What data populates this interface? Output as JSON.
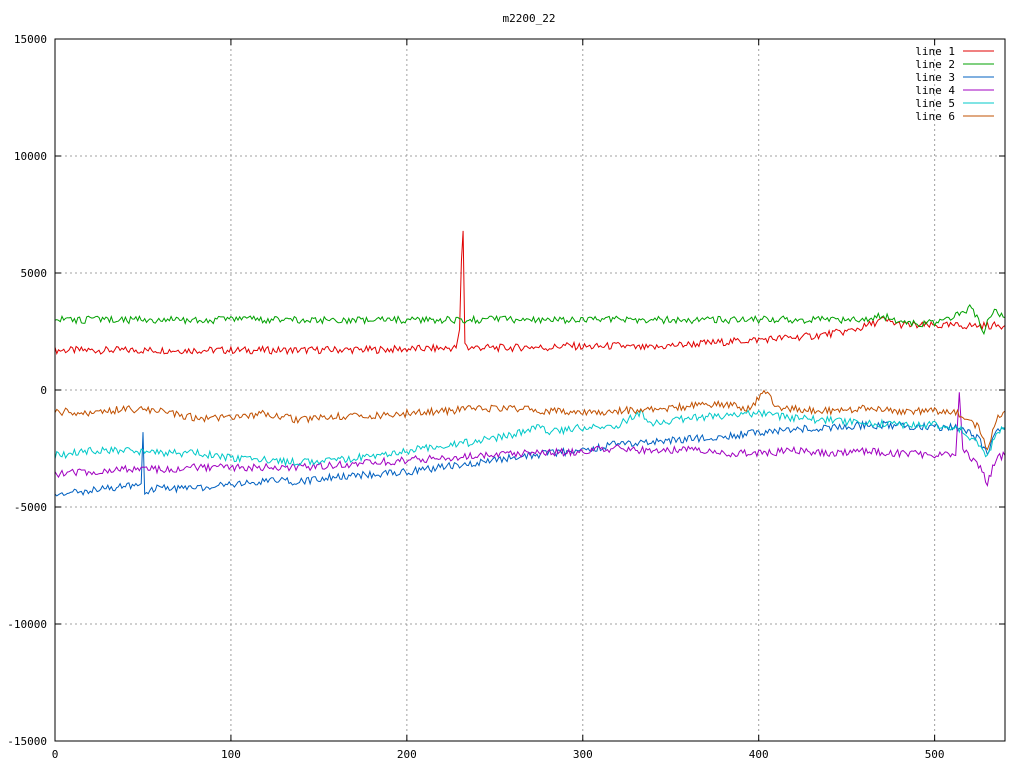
{
  "chart_data": {
    "type": "line",
    "title": "m2200_22",
    "xlabel": "",
    "ylabel": "",
    "xlim": [
      0,
      540
    ],
    "ylim": [
      -15000,
      15000
    ],
    "x_ticks": [
      0,
      100,
      200,
      300,
      400,
      500
    ],
    "y_ticks": [
      -15000,
      -10000,
      -5000,
      0,
      5000,
      10000,
      15000
    ],
    "grid": true,
    "legend_position": "top-right",
    "series": [
      {
        "name": "line 1",
        "color": "#e00000",
        "points": [
          [
            0,
            1700
          ],
          [
            20,
            1700
          ],
          [
            40,
            1700
          ],
          [
            60,
            1700
          ],
          [
            80,
            1700
          ],
          [
            100,
            1700
          ],
          [
            120,
            1700
          ],
          [
            140,
            1700
          ],
          [
            160,
            1720
          ],
          [
            180,
            1720
          ],
          [
            200,
            1750
          ],
          [
            220,
            1780
          ],
          [
            228,
            1800
          ],
          [
            230,
            2600
          ],
          [
            231,
            5500
          ],
          [
            232,
            6800
          ],
          [
            233,
            2000
          ],
          [
            235,
            1800
          ],
          [
            240,
            1820
          ],
          [
            250,
            1800
          ],
          [
            260,
            1800
          ],
          [
            270,
            1850
          ],
          [
            280,
            1800
          ],
          [
            290,
            1900
          ],
          [
            300,
            1850
          ],
          [
            310,
            1850
          ],
          [
            320,
            1900
          ],
          [
            330,
            1800
          ],
          [
            340,
            1800
          ],
          [
            350,
            1900
          ],
          [
            360,
            1950
          ],
          [
            370,
            2000
          ],
          [
            380,
            2050
          ],
          [
            390,
            2100
          ],
          [
            400,
            2150
          ],
          [
            410,
            2200
          ],
          [
            420,
            2250
          ],
          [
            430,
            2300
          ],
          [
            440,
            2400
          ],
          [
            450,
            2500
          ],
          [
            460,
            2700
          ],
          [
            470,
            3000
          ],
          [
            480,
            2800
          ],
          [
            490,
            2750
          ],
          [
            500,
            2750
          ],
          [
            510,
            2750
          ],
          [
            520,
            2750
          ],
          [
            530,
            2750
          ],
          [
            540,
            2750
          ]
        ]
      },
      {
        "name": "line 2",
        "color": "#00a000",
        "points": [
          [
            0,
            3000
          ],
          [
            100,
            3000
          ],
          [
            200,
            3000
          ],
          [
            300,
            3000
          ],
          [
            400,
            3000
          ],
          [
            460,
            3000
          ],
          [
            470,
            3200
          ],
          [
            480,
            2900
          ],
          [
            490,
            2800
          ],
          [
            500,
            2900
          ],
          [
            505,
            3000
          ],
          [
            510,
            3100
          ],
          [
            515,
            3300
          ],
          [
            520,
            3500
          ],
          [
            525,
            3000
          ],
          [
            528,
            2400
          ],
          [
            530,
            2900
          ],
          [
            535,
            3400
          ],
          [
            540,
            3100
          ]
        ]
      },
      {
        "name": "line 3",
        "color": "#0060c0",
        "points": [
          [
            0,
            -4600
          ],
          [
            10,
            -4400
          ],
          [
            20,
            -4300
          ],
          [
            30,
            -4200
          ],
          [
            40,
            -4100
          ],
          [
            49,
            -4000
          ],
          [
            50,
            -1800
          ],
          [
            51,
            -4300
          ],
          [
            60,
            -4200
          ],
          [
            80,
            -4200
          ],
          [
            100,
            -4000
          ],
          [
            120,
            -3900
          ],
          [
            140,
            -3900
          ],
          [
            160,
            -3700
          ],
          [
            180,
            -3600
          ],
          [
            200,
            -3500
          ],
          [
            220,
            -3300
          ],
          [
            240,
            -3100
          ],
          [
            260,
            -2900
          ],
          [
            280,
            -2700
          ],
          [
            300,
            -2600
          ],
          [
            320,
            -2300
          ],
          [
            340,
            -2200
          ],
          [
            360,
            -2100
          ],
          [
            380,
            -2000
          ],
          [
            400,
            -1800
          ],
          [
            420,
            -1700
          ],
          [
            440,
            -1600
          ],
          [
            460,
            -1500
          ],
          [
            480,
            -1500
          ],
          [
            500,
            -1600
          ],
          [
            515,
            -1600
          ],
          [
            525,
            -2100
          ],
          [
            530,
            -2800
          ],
          [
            535,
            -1800
          ],
          [
            540,
            -1700
          ]
        ]
      },
      {
        "name": "line 4",
        "color": "#a000c0",
        "points": [
          [
            0,
            -3600
          ],
          [
            20,
            -3500
          ],
          [
            40,
            -3400
          ],
          [
            60,
            -3400
          ],
          [
            80,
            -3300
          ],
          [
            100,
            -3300
          ],
          [
            120,
            -3300
          ],
          [
            140,
            -3300
          ],
          [
            160,
            -3200
          ],
          [
            180,
            -3100
          ],
          [
            200,
            -3000
          ],
          [
            220,
            -2900
          ],
          [
            240,
            -2800
          ],
          [
            260,
            -2700
          ],
          [
            280,
            -2700
          ],
          [
            300,
            -2600
          ],
          [
            320,
            -2500
          ],
          [
            340,
            -2600
          ],
          [
            360,
            -2500
          ],
          [
            380,
            -2700
          ],
          [
            400,
            -2700
          ],
          [
            420,
            -2600
          ],
          [
            440,
            -2700
          ],
          [
            460,
            -2600
          ],
          [
            480,
            -2700
          ],
          [
            500,
            -2800
          ],
          [
            512,
            -2800
          ],
          [
            514,
            -100
          ],
          [
            516,
            -2500
          ],
          [
            525,
            -3200
          ],
          [
            530,
            -4000
          ],
          [
            535,
            -2900
          ],
          [
            540,
            -2800
          ]
        ]
      },
      {
        "name": "line 5",
        "color": "#00c8c8",
        "points": [
          [
            0,
            -2800
          ],
          [
            20,
            -2600
          ],
          [
            40,
            -2600
          ],
          [
            60,
            -2700
          ],
          [
            80,
            -2700
          ],
          [
            100,
            -2900
          ],
          [
            120,
            -3000
          ],
          [
            140,
            -3100
          ],
          [
            160,
            -3000
          ],
          [
            180,
            -2800
          ],
          [
            200,
            -2600
          ],
          [
            220,
            -2400
          ],
          [
            240,
            -2200
          ],
          [
            260,
            -1900
          ],
          [
            275,
            -1600
          ],
          [
            280,
            -1800
          ],
          [
            300,
            -1600
          ],
          [
            320,
            -1500
          ],
          [
            333,
            -1000
          ],
          [
            340,
            -1400
          ],
          [
            360,
            -1200
          ],
          [
            380,
            -1100
          ],
          [
            400,
            -1000
          ],
          [
            420,
            -1200
          ],
          [
            440,
            -1300
          ],
          [
            460,
            -1400
          ],
          [
            480,
            -1500
          ],
          [
            500,
            -1500
          ],
          [
            515,
            -1700
          ],
          [
            525,
            -2300
          ],
          [
            530,
            -2900
          ],
          [
            535,
            -1900
          ],
          [
            540,
            -1600
          ]
        ]
      },
      {
        "name": "line 6",
        "color": "#c05000",
        "points": [
          [
            0,
            -900
          ],
          [
            20,
            -1000
          ],
          [
            40,
            -800
          ],
          [
            60,
            -900
          ],
          [
            80,
            -1200
          ],
          [
            100,
            -1200
          ],
          [
            120,
            -1000
          ],
          [
            140,
            -1300
          ],
          [
            160,
            -1100
          ],
          [
            180,
            -1100
          ],
          [
            200,
            -1000
          ],
          [
            220,
            -900
          ],
          [
            240,
            -800
          ],
          [
            260,
            -800
          ],
          [
            280,
            -900
          ],
          [
            300,
            -1000
          ],
          [
            320,
            -900
          ],
          [
            340,
            -800
          ],
          [
            360,
            -700
          ],
          [
            380,
            -600
          ],
          [
            395,
            -800
          ],
          [
            403,
            0
          ],
          [
            410,
            -700
          ],
          [
            420,
            -800
          ],
          [
            440,
            -900
          ],
          [
            460,
            -800
          ],
          [
            480,
            -900
          ],
          [
            500,
            -900
          ],
          [
            515,
            -1000
          ],
          [
            525,
            -1600
          ],
          [
            530,
            -2500
          ],
          [
            535,
            -1300
          ],
          [
            540,
            -900
          ]
        ]
      }
    ]
  }
}
